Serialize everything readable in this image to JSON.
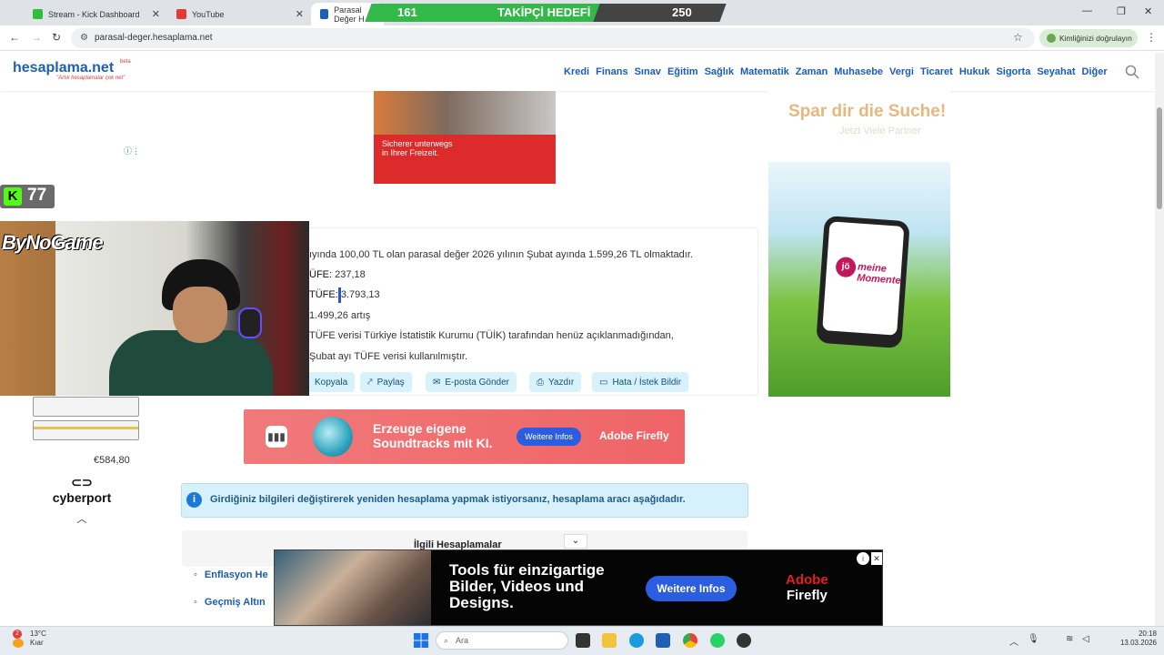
{
  "browser": {
    "tabs": [
      {
        "title": "Stream - Kick Dashboard",
        "color": "#2fbf3a"
      },
      {
        "title": "YouTube",
        "color": "#e53935"
      },
      {
        "title": "Parasal Değer H",
        "color": "#1c5fb5"
      }
    ],
    "url": "parasal-deger.hesaplama.net",
    "profile_label": "Kimliğinizi doğrulayın"
  },
  "goal": {
    "current": "161",
    "label": "TAKİPÇİ HEDEFİ",
    "target": "250",
    "progress": 0.644
  },
  "site": {
    "logo": "hesaplama.net",
    "tagline": "\"Artık hesaplamalar çok net\"",
    "beta": "beta",
    "nav": [
      "Kredi",
      "Finans",
      "Sınav",
      "Eğitim",
      "Sağlık",
      "Matematik",
      "Zaman",
      "Muhasebe",
      "Vergi",
      "Ticaret",
      "Hukuk",
      "Sigorta",
      "Seyahat",
      "Diğer"
    ]
  },
  "ads": {
    "top_text1": "Sicherer unterwegs",
    "top_text2": "in Ihrer Freizeit.",
    "right_heading": "Spar dir die Suche!",
    "right_sub": "Jetzt Viele Partner",
    "right_brand_dot": "jö",
    "right_brand": "meine Momente",
    "left_price": "€584,80",
    "left_brand": "cyberport",
    "mid_headline1": "Erzeuge eigene",
    "mid_headline2": "Soundtracks mit KI.",
    "mid_button": "Weitere Infos",
    "mid_brand": "Adobe Firefly",
    "bottom_headline1": "Tools für einzigartige",
    "bottom_headline2": "Bilder, Videos und",
    "bottom_headline3": "Designs.",
    "bottom_button": "Weitere Infos",
    "bottom_brand1": "Adobe",
    "bottom_brand2": "Firefly"
  },
  "result": {
    "line1": "ıyında 100,00 TL olan parasal değer 2026 yılının Şubat ayında 1.599,26 TL olmaktadır.",
    "line2_label": "ÜFE:",
    "line2_value": "237,18",
    "line3_label": "TÜFE:",
    "line3_value": "3.793,13",
    "line4": "1.499,26 artış",
    "line5": "TÜFE verisi Türkiye İstatistik Kurumu (TÜİK) tarafından henüz açıklanmadığından,",
    "line6": "Şubat ayı TÜFE verisi kullanılmıştır."
  },
  "actions": [
    "Kopyala",
    "Paylaş",
    "E-posta Gönder",
    "Yazdır",
    "Hata / İstek Bildir"
  ],
  "info": "Girdiğiniz bilgileri değiştirerek yeniden hesaplama yapmak istiyorsanız, hesaplama aracı aşağıdadır.",
  "related": {
    "title": "İlgili Hesaplamalar",
    "items": [
      "Enflasyon He",
      "Geçmiş Altın"
    ]
  },
  "stream": {
    "streamer": "ByNoGame",
    "kick_letter": "K",
    "viewers": "77"
  },
  "taskbar": {
    "temp": "13°C",
    "weather": "Kıar",
    "search": "Ara",
    "time": "20:18",
    "date": "13.03.2026",
    "notif_badge": "2"
  }
}
